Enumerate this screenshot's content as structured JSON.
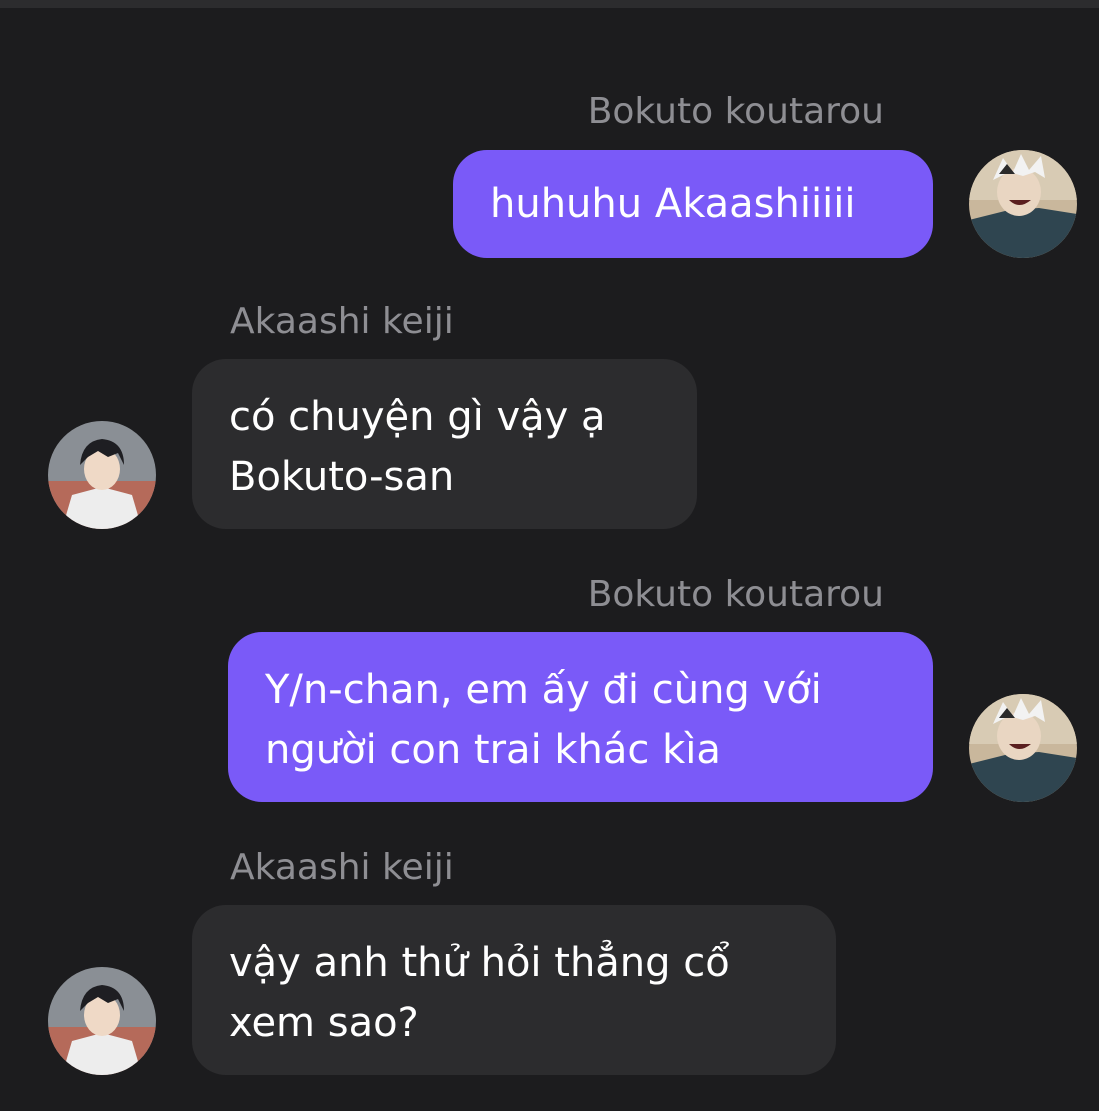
{
  "colors": {
    "background": "#1c1c1e",
    "outgoing_bubble": "#7a5af8",
    "incoming_bubble": "#2c2c2e",
    "sender_text": "#8e8e93",
    "message_text": "#ffffff"
  },
  "messages": [
    {
      "sender": "Bokuto koutarou",
      "direction": "outgoing",
      "avatar": "bokuto-avatar",
      "lines": [
        "huhuhu Akaashiiiii"
      ]
    },
    {
      "sender": "Akaashi keiji",
      "direction": "incoming",
      "avatar": "akaashi-avatar",
      "lines": [
        "có chuyện gì vậy ạ",
        "Bokuto-san"
      ]
    },
    {
      "sender": "Bokuto koutarou",
      "direction": "outgoing",
      "avatar": "bokuto-avatar",
      "lines": [
        "Y/n-chan, em ấy đi cùng với",
        "người con trai khác kìa"
      ]
    },
    {
      "sender": "Akaashi keiji",
      "direction": "incoming",
      "avatar": "akaashi-avatar",
      "lines": [
        "vậy anh thử hỏi thẳng cổ",
        "xem sao?"
      ]
    }
  ]
}
